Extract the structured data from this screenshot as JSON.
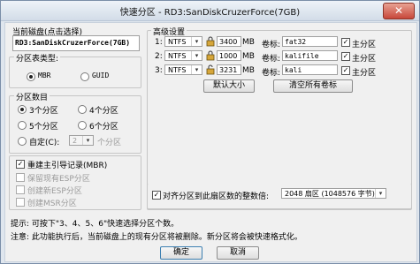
{
  "window": {
    "title": "快速分区 - RD3:SanDiskCruzerForce(7GB)",
    "close_glyph": "✕"
  },
  "current_disk": {
    "label": "当前磁盘(点击选择)",
    "value": "RD3:SanDiskCruzerForce(7GB)"
  },
  "partition_table": {
    "label": "分区表类型:",
    "options": [
      "MBR",
      "GUID"
    ],
    "selected": "MBR"
  },
  "partition_count": {
    "label": "分区数目",
    "options": [
      "3个分区",
      "4个分区",
      "5个分区",
      "6个分区",
      "自定(C):"
    ],
    "selected": "3个分区",
    "custom_value": "2",
    "custom_suffix": "个分区"
  },
  "boot_options": [
    {
      "label": "重建主引导记录(MBR)",
      "checked": true,
      "enabled": true
    },
    {
      "label": "保留现有ESP分区",
      "checked": false,
      "enabled": false
    },
    {
      "label": "创建新ESP分区",
      "checked": false,
      "enabled": false
    },
    {
      "label": "创建MSR分区",
      "checked": false,
      "enabled": false
    }
  ],
  "advanced": {
    "label": "高级设置",
    "volume_label_text": "卷标:",
    "primary_label": "主分区",
    "unit_glyph": "▾",
    "rows": [
      {
        "index": "1:",
        "fs": "NTFS",
        "size": "3400",
        "unit": "MB",
        "volume": "fat32",
        "primary": true
      },
      {
        "index": "2:",
        "fs": "NTFS",
        "size": "1000",
        "unit": "MB",
        "volume": "kalifile",
        "primary": true
      },
      {
        "index": "3:",
        "fs": "NTFS",
        "size": "3231",
        "unit": "MB",
        "volume": "kali",
        "primary": true
      }
    ],
    "default_size_button": "默认大小",
    "clear_labels_button": "清空所有卷标"
  },
  "align": {
    "label": "对齐分区到此扇区数的整数倍:",
    "checked": true,
    "value": "2048 扇区 (1048576 字节)"
  },
  "hints": [
    "提示: 可按下\"3、4、5、6\"快速选择分区个数。",
    "注意: 此功能执行后，当前磁盘上的现有分区将被删除。新分区将会被快速格式化。"
  ],
  "buttons": {
    "ok": "确定",
    "cancel": "取消"
  }
}
